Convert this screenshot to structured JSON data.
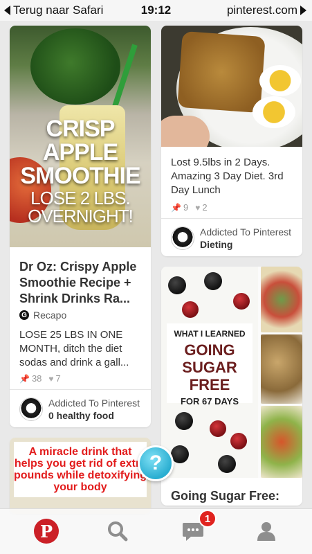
{
  "status_bar": {
    "back_label": "Terug naar Safari",
    "time": "19:12",
    "domain": "pinterest.com"
  },
  "pins": [
    {
      "image_overlay_big": "CRISP APPLE SMOOTHIE",
      "image_overlay_small": "LOSE 2 LBS. OVERNIGHT!",
      "title": "Dr Oz: Crispy Apple Smoothie Recipe + Shrink Drinks Ra...",
      "source": "Recapo",
      "description": "LOSE 25 LBS IN ONE MONTH, ditch the diet sodas and drink a gall...",
      "repins": "38",
      "likes": "7",
      "board_owner": "Addicted To Pinterest",
      "board_name": "0 healthy food"
    },
    {
      "title": "Lost 9.5lbs in 2 Days. Amazing 3 Day Diet. 3rd Day Lunch",
      "repins": "9",
      "likes": "2",
      "board_owner": "Addicted To Pinterest",
      "board_name": "Dieting"
    },
    {
      "image_line1": "WHAT I LEARNED",
      "image_line2": "GOING SUGAR FREE",
      "image_line3": "FOR 67 DAYS",
      "title": "Going Sugar Free: What I Haven't Told You"
    },
    {
      "image_text": "A miracle drink that helps you get rid of extra pounds while detoxifying your body"
    }
  ],
  "help_button": {
    "label": "?"
  },
  "tab_bar": {
    "home_icon": "pinterest-logo",
    "search_icon": "search-icon",
    "messages_icon": "chat-icon",
    "messages_badge": "1",
    "profile_icon": "person-icon"
  },
  "colors": {
    "brand_red": "#cb2027",
    "badge_red": "#e0231f",
    "help_blue": "#2aaed1",
    "image_text_red": "#e21c1c"
  }
}
